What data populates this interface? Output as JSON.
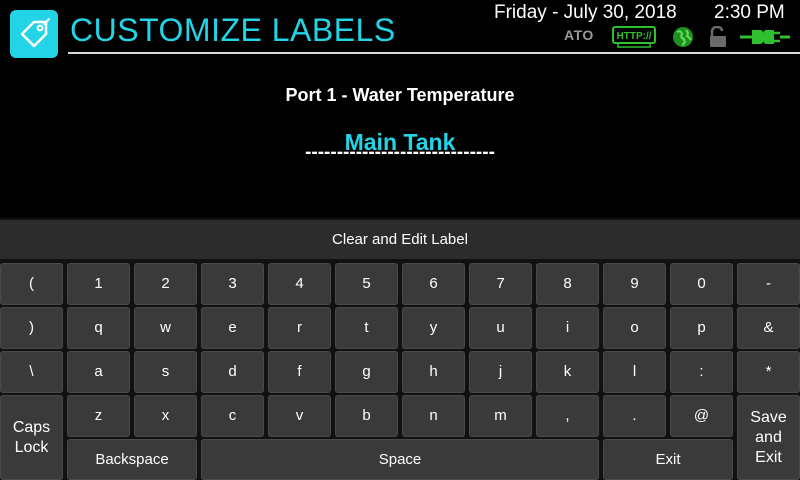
{
  "header": {
    "title": "CUSTOMIZE LABELS",
    "date": "Friday - July 30, 2018",
    "time": "2:30 PM",
    "status": {
      "ato_label": "ATO",
      "http_label": "HTTP://",
      "icons": [
        "tag-icon",
        "http-icon",
        "globe-icon",
        "unlocked-lock-icon",
        "plug-icon"
      ]
    }
  },
  "label_editor": {
    "port_title": "Port 1 - Water Temperature",
    "value": "Main Tank",
    "underline": "------------------------------"
  },
  "keyboard": {
    "clear_edit_label": "Clear and Edit Label",
    "row1": [
      "(",
      "1",
      "2",
      "3",
      "4",
      "5",
      "6",
      "7",
      "8",
      "9",
      "0",
      "-"
    ],
    "row2": [
      ")",
      "q",
      "w",
      "e",
      "r",
      "t",
      "y",
      "u",
      "i",
      "o",
      "p",
      "&"
    ],
    "row3": [
      "\\",
      "a",
      "s",
      "d",
      "f",
      "g",
      "h",
      "j",
      "k",
      "l",
      ":",
      "*"
    ],
    "row4": [
      "z",
      "x",
      "c",
      "v",
      "b",
      "n",
      "m",
      ",",
      ".",
      "@"
    ],
    "caps_lock": "Caps\nLock",
    "save_exit": "Save\nand\nExit",
    "backspace": "Backspace",
    "space": "Space",
    "exit": "Exit"
  },
  "colors": {
    "accent": "#22d4e6",
    "background": "#000000",
    "key": "#3a3a3a",
    "status_green": "#2fbf2f"
  }
}
